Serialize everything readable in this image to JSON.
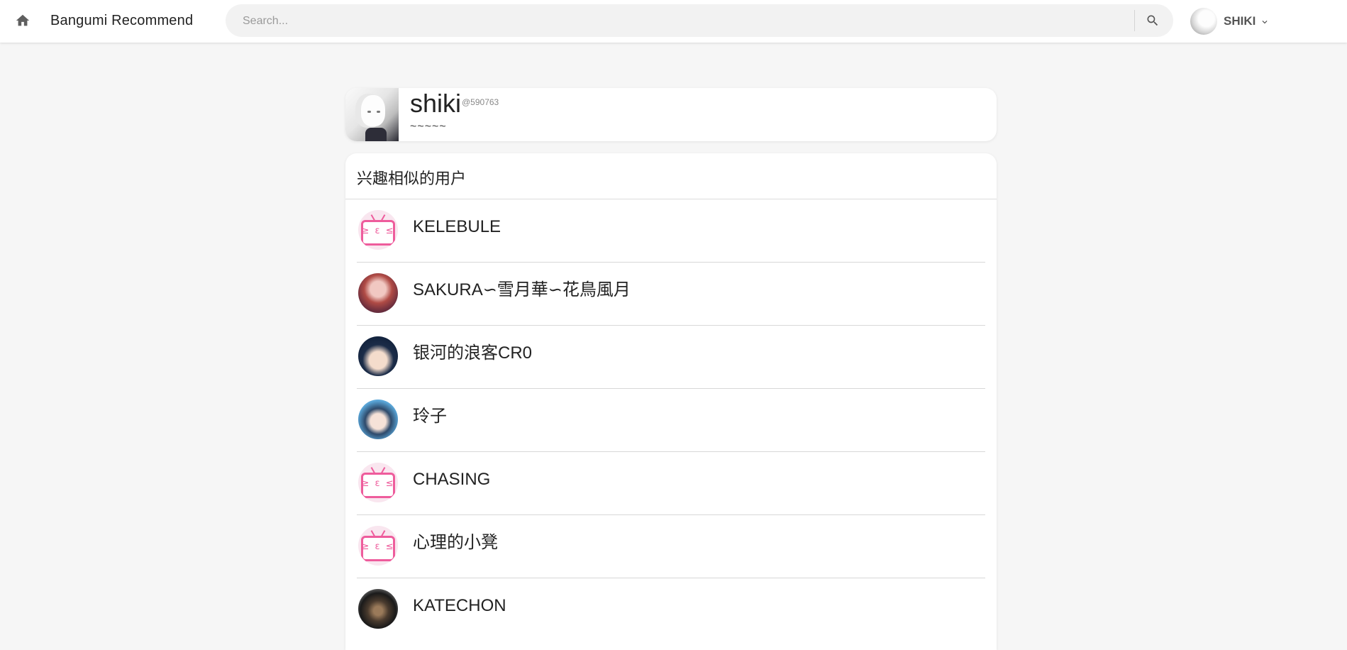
{
  "header": {
    "home_icon": "home-icon",
    "app_title": "Bangumi Recommend",
    "search_placeholder": "Search...",
    "search_value": "",
    "search_icon": "search-icon",
    "user_name": "SHIKI",
    "user_avatar_icon": "avatar",
    "menu_icon": "chevron-down-icon"
  },
  "profile": {
    "name": "shiki",
    "uid": "@590763",
    "signature": "~~~~~"
  },
  "similar_users": {
    "title": "兴趣相似的用户",
    "users": [
      {
        "name": "KELEBULE",
        "avatar": "tv-avatar",
        "avatar_face": "≥ ε ≤"
      },
      {
        "name": "SAKURA∽雪月華∽花鳥風月",
        "avatar": "anime-avatar"
      },
      {
        "name": "银河的浪客CR0",
        "avatar": "anime-avatar"
      },
      {
        "name": "玲子",
        "avatar": "anime-avatar"
      },
      {
        "name": "CHASING",
        "avatar": "tv-avatar",
        "avatar_face": "≥ ε ≤"
      },
      {
        "name": "心理的小凳",
        "avatar": "tv-avatar",
        "avatar_face": "≥ ε ≤"
      },
      {
        "name": "KATECHON",
        "avatar": "game-avatar"
      }
    ]
  },
  "colors": {
    "background": "#f6f6f6",
    "card": "#ffffff",
    "accent_pink": "#ee5c9c"
  }
}
